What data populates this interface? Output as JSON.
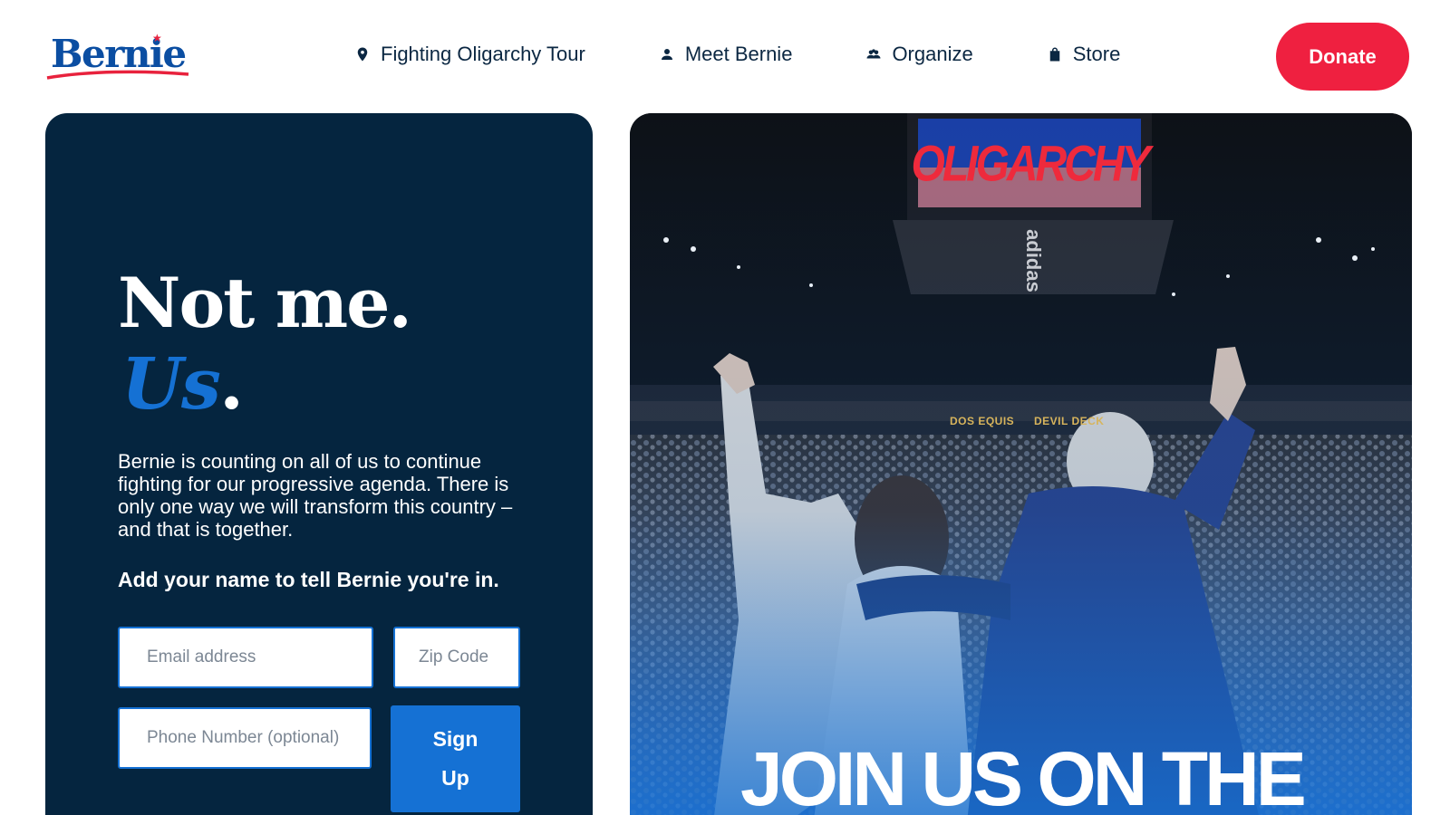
{
  "header": {
    "logo_text": "Bernie",
    "nav": [
      {
        "label": "Fighting Oligarchy Tour",
        "icon": "location-pin-icon"
      },
      {
        "label": "Meet Bernie",
        "icon": "person-icon"
      },
      {
        "label": "Organize",
        "icon": "group-icon"
      },
      {
        "label": "Store",
        "icon": "shopping-bag-icon"
      }
    ],
    "donate_label": "Donate"
  },
  "signup": {
    "headline_line1": "Not me.",
    "headline_us": "Us",
    "headline_dot": ".",
    "body": "Bernie is counting on all of us to continue fighting for our progressive agenda. There is only one way we will transform this country – and that is together.",
    "cta": "Add your name to tell Bernie you're in.",
    "email_placeholder": "Email address",
    "zip_placeholder": "Zip Code",
    "phone_placeholder": "Phone Number (optional)",
    "submit_line1": "Sign",
    "submit_line2": "Up"
  },
  "photo": {
    "screen_text": "OLIGARCHY",
    "sign_left": "DOS EQUIS",
    "sign_right": "DEVIL DECK",
    "brand_text": "adidas",
    "overlay_text": "JOIN US ON THE"
  },
  "colors": {
    "navy": "#05253f",
    "brand_blue": "#1571d4",
    "donate_red": "#ef2040",
    "text_dark": "#0b2742"
  }
}
